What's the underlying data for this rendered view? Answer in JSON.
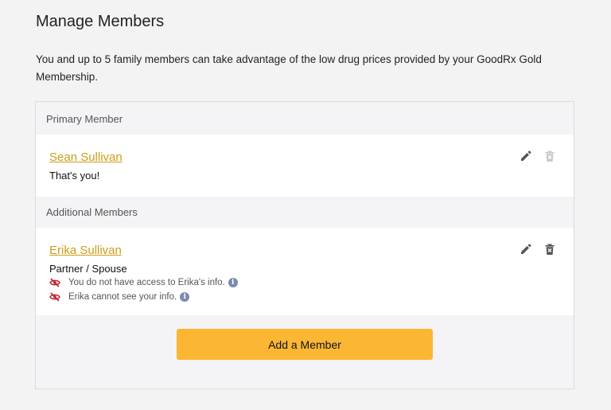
{
  "page": {
    "title": "Manage Members",
    "intro": "You and up to 5 family members can take advantage of the low drug prices provided by your GoodRx Gold Membership."
  },
  "primary_section": {
    "heading": "Primary Member",
    "member": {
      "name": "Sean Sullivan",
      "subtitle": "That's you!",
      "edit_icon": "pencil-icon",
      "delete_icon": "trash-icon",
      "delete_enabled": false
    }
  },
  "additional_section": {
    "heading": "Additional Members",
    "members": [
      {
        "name": "Erika Sullivan",
        "relation": "Partner / Spouse",
        "privacy": [
          "You do not have access to Erika's info.",
          "Erika cannot see your info."
        ],
        "privacy_icon": "eye-slash-icon",
        "info_icon": "info-icon",
        "info_glyph": "i",
        "edit_icon": "pencil-icon",
        "delete_icon": "trash-icon",
        "delete_enabled": true
      }
    ]
  },
  "add_button": {
    "label": "Add a Member"
  },
  "colors": {
    "background": "#f3f3f3",
    "link": "#cf9d17",
    "button": "#fbb734",
    "privacy_icon": "#c3202e",
    "info_badge": "#7a8bb0",
    "icon_active": "#555555",
    "icon_disabled": "#c8c8c8"
  }
}
